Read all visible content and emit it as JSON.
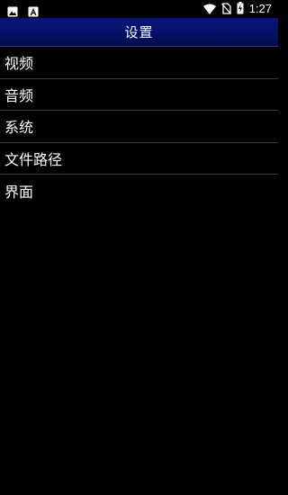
{
  "status_bar": {
    "time": "1:27",
    "left_icons": [
      "image-icon",
      "text-a-icon"
    ],
    "right_icons": [
      "wifi-icon",
      "no-sim-icon",
      "battery-charging-icon"
    ]
  },
  "title_bar": {
    "title": "设置"
  },
  "settings": {
    "items": [
      {
        "label": "视频"
      },
      {
        "label": "音频"
      },
      {
        "label": "系统"
      },
      {
        "label": "文件路径"
      },
      {
        "label": "界面"
      }
    ]
  }
}
